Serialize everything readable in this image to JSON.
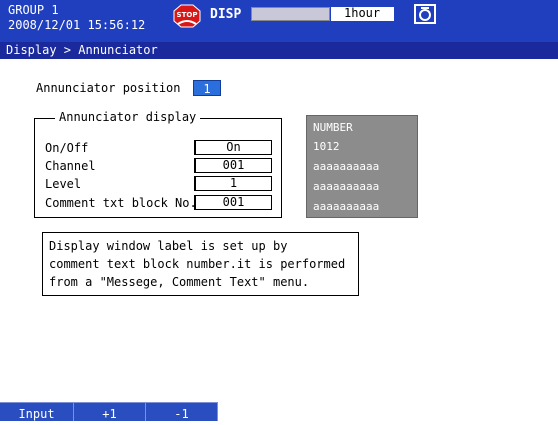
{
  "header": {
    "group_line1": "GROUP 1",
    "group_line2": "2008/12/01 15:56:12",
    "stop_icon": "stop-status-icon",
    "disp_label": "DISP",
    "disp_value": "1hour",
    "camera_icon": "camera-icon",
    "bar_color": "#1f3fbf"
  },
  "breadcrumb": "Display > Annunciator",
  "annunciator_position": {
    "label": "Annunciator position",
    "value": "1"
  },
  "annunciator_display": {
    "title": "Annunciator display",
    "rows": [
      {
        "label": "On/Off",
        "value": "On"
      },
      {
        "label": "Channel",
        "value": "001"
      },
      {
        "label": "Level",
        "value": "1"
      },
      {
        "label": "Comment txt block No.",
        "value": "001"
      }
    ]
  },
  "preview": {
    "lines": [
      "NUMBER",
      "1012",
      "aaaaaaaaaa",
      "aaaaaaaaaa",
      "aaaaaaaaaa"
    ]
  },
  "help": {
    "line1": "Display window label is set up by",
    "line2": "comment text block number.it is performed",
    "line3": "from a \"Messege, Comment Text\" menu."
  },
  "softkeys": [
    "Input",
    "+1",
    "-1"
  ]
}
